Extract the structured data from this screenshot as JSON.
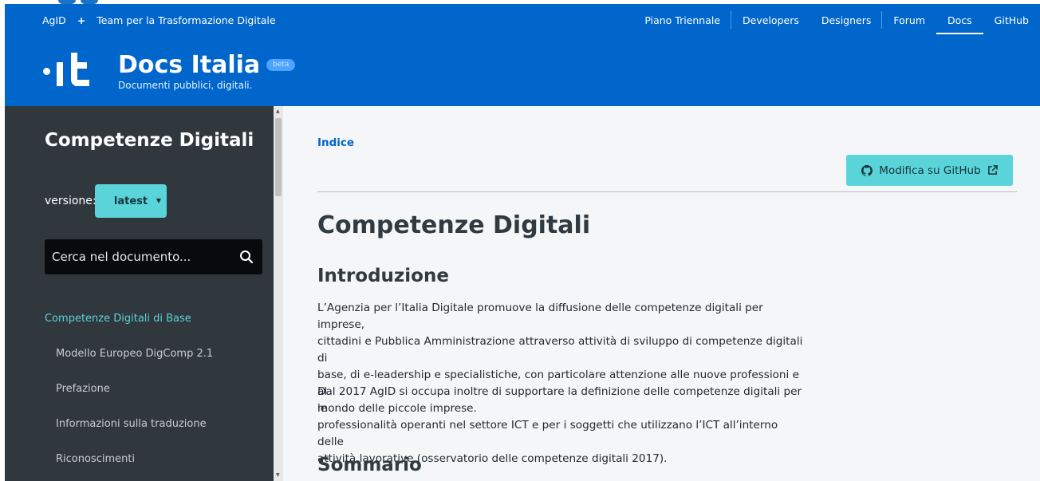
{
  "topbar": {
    "org": "AgID",
    "plus": "+",
    "team": "Team per la Trasformazione Digitale",
    "nav": [
      "Piano Triennale",
      "Developers",
      "Designers",
      "Forum",
      "Docs",
      "GitHub"
    ],
    "active_nav": "Docs"
  },
  "header": {
    "title": "Docs Italia",
    "badge": "beta",
    "subtitle": "Documenti pubblici, digitali."
  },
  "sidebar": {
    "title": "Competenze Digitali",
    "version_label": "versione:",
    "version_value": "latest",
    "search_placeholder": "Cerca nel documento...",
    "items": [
      {
        "label": "Competenze Digitali di Base",
        "active": true
      },
      {
        "label": "Modello Europeo DigComp 2.1"
      },
      {
        "label": "Prefazione"
      },
      {
        "label": "Informazioni sulla traduzione"
      },
      {
        "label": "Riconoscimenti"
      }
    ]
  },
  "main": {
    "breadcrumb": "Indice",
    "edit_button": "Modifica su GitHub",
    "h1": "Competenze Digitali",
    "section1_title": "Introduzione",
    "para1_lines": [
      "L’Agenzia per l’Italia Digitale promuove la diffusione delle competenze digitali per imprese,",
      "cittadini e Pubblica Amministrazione attraverso attività di sviluppo di competenze digitali di",
      "base, di e-leadership e specialistiche, con particolare attenzione alle nuove professioni e al",
      "mondo delle piccole imprese."
    ],
    "para2_lines": [
      "Dal 2017 AgID si occupa inoltre di supportare la definizione delle competenze digitali per le",
      "professionalità operanti nel settore ICT e per i soggetti che utilizzano l’ICT all’interno delle",
      "attività lavorative (osservatorio delle competenze digitali 2017)."
    ],
    "section2_title": "Sommario"
  },
  "colors": {
    "brand_blue": "#0066cc",
    "accent_teal": "#5ad4d8",
    "sidebar_bg": "#30373d"
  }
}
